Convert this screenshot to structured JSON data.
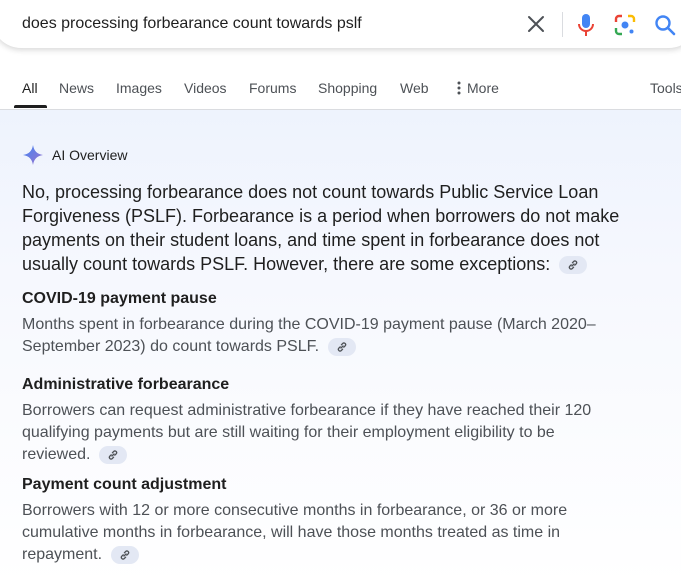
{
  "search": {
    "query": "does processing forbearance count towards pslf"
  },
  "tabs": [
    {
      "label": "All"
    },
    {
      "label": "News"
    },
    {
      "label": "Images"
    },
    {
      "label": "Videos"
    },
    {
      "label": "Forums"
    },
    {
      "label": "Shopping"
    },
    {
      "label": "Web"
    },
    {
      "label": "More"
    },
    {
      "label": "Tools"
    }
  ],
  "ai_overview": {
    "title": "AI Overview",
    "summary": "No, processing forbearance does not count towards Public Service Loan Forgiveness (PSLF). Forbearance is a period when borrowers do not make payments on their student loans, and time spent in forbearance does not usually count towards PSLF. However, there are some exceptions:",
    "sections": [
      {
        "title": "COVID-19 payment pause",
        "body": "Months spent in forbearance during the COVID-19 payment pause (March 2020–September 2023) do count towards PSLF."
      },
      {
        "title": "Administrative forbearance",
        "body": "Borrowers can request administrative forbearance if they have reached their 120 qualifying payments but are still waiting for their employment eligibility to be reviewed."
      },
      {
        "title": "Payment count adjustment",
        "body": "Borrowers with 12 or more consecutive months in forbearance, or 36 or more cumulative months in forbearance, will have those months treated as time in repayment."
      }
    ]
  },
  "colors": {
    "accent_blue": "#4285f4",
    "mic_red": "#ea4335",
    "text_primary": "#1f1f1f",
    "text_secondary": "#4d5156",
    "chip_bg": "#e3e8f4"
  },
  "icons": [
    "close-icon",
    "mic-icon",
    "lens-icon",
    "search-icon",
    "more-dots-icon",
    "sparkle-icon",
    "link-icon"
  ]
}
